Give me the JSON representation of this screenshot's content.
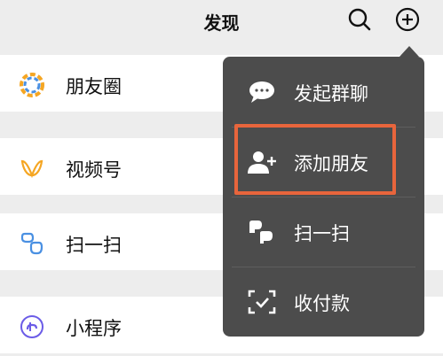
{
  "header": {
    "title": "发现"
  },
  "list": {
    "items": [
      {
        "label": "朋友圈",
        "icon": "moments-icon"
      },
      {
        "label": "视频号",
        "icon": "channels-icon"
      },
      {
        "label": "扫一扫",
        "icon": "scan-icon"
      },
      {
        "label": "小程序",
        "icon": "mini-program-icon"
      }
    ]
  },
  "menu": {
    "items": [
      {
        "label": "发起群聊",
        "icon": "chat-bubble-icon"
      },
      {
        "label": "添加朋友",
        "icon": "add-user-icon"
      },
      {
        "label": "扫一扫",
        "icon": "scan-icon"
      },
      {
        "label": "收付款",
        "icon": "payment-icon"
      }
    ],
    "highlighted_item": "添加朋友"
  },
  "colors": {
    "menu_background": "#4c4c4c",
    "highlight_border": "#e8653c",
    "page_background": "#ededed",
    "channels_icon": "#f5a623",
    "scan_icon": "#4a90e2",
    "mini_program_icon": "#6b5ce7"
  }
}
